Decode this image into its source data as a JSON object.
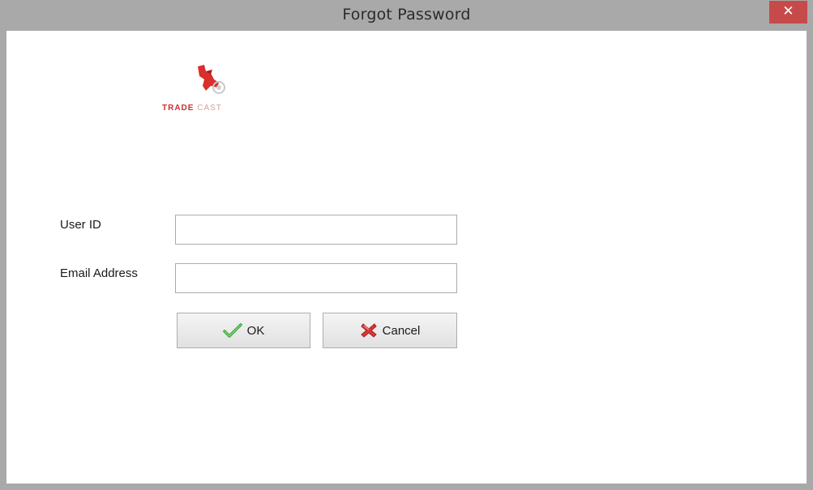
{
  "window": {
    "title": "Forgot Password",
    "close_glyph": "✕"
  },
  "logo": {
    "word1": "TRADE",
    "word2": "CAST"
  },
  "form": {
    "user_id_label": "User ID",
    "user_id_value": "",
    "email_label": "Email Address",
    "email_value": ""
  },
  "buttons": {
    "ok_label": "OK",
    "ok_icon": "checkmark-icon",
    "cancel_label": "Cancel",
    "cancel_icon": "red-x-icon"
  },
  "colors": {
    "titlebar": "#a9a9a9",
    "close_button": "#c74a4a",
    "logo_red": "#cf2e2e"
  }
}
